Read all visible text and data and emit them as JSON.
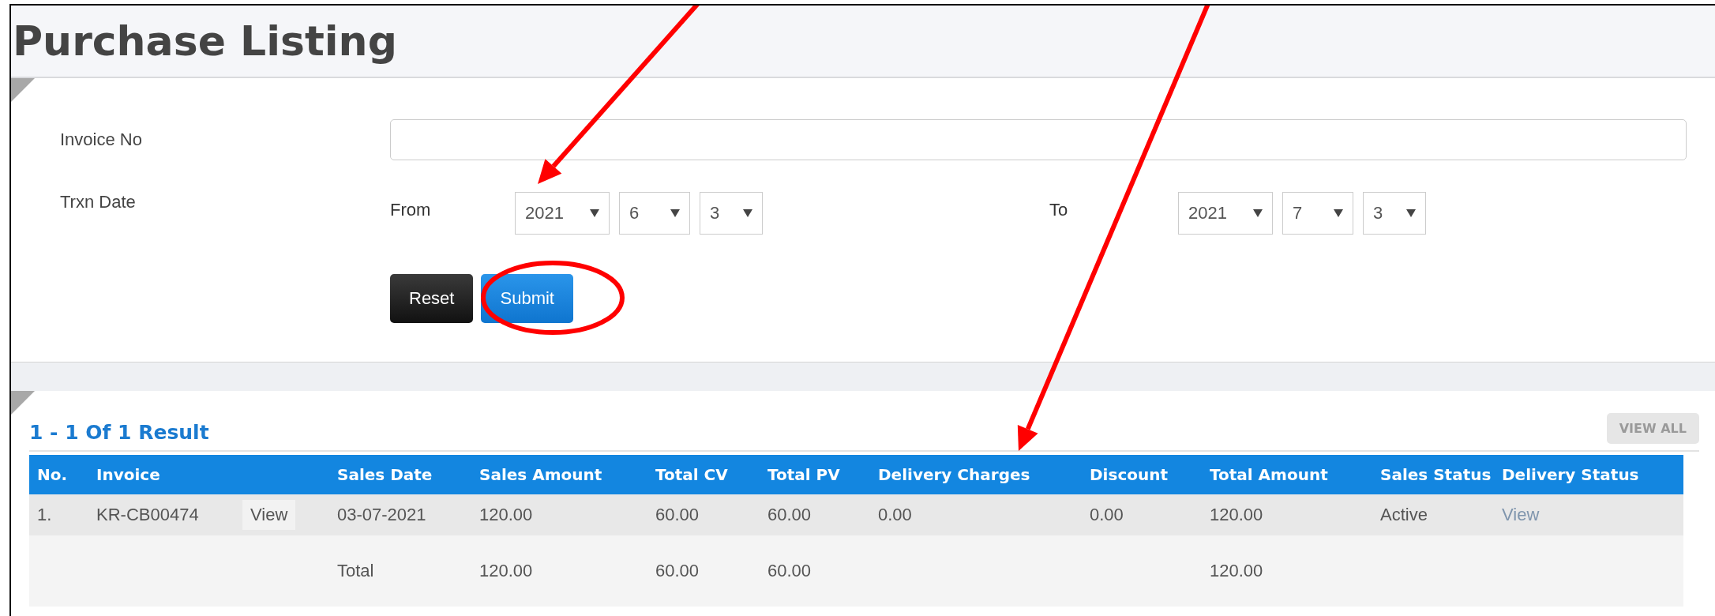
{
  "page_title": "Purchase Listing",
  "filter": {
    "invoice_label": "Invoice No",
    "date_label": "Trxn Date",
    "ranges": [
      {
        "label": "From",
        "year": "2021",
        "month": "6",
        "day": "3"
      },
      {
        "label": "To",
        "year": "2021",
        "month": "7",
        "day": "3"
      }
    ],
    "buttons": [
      {
        "label": "Reset",
        "kind": "dark"
      },
      {
        "label": "Submit",
        "kind": "primary"
      }
    ]
  },
  "results": {
    "summary": "1 - 1 Of 1 Result",
    "view_all": "VIEW ALL",
    "columns": [
      "No.",
      "Invoice",
      "Sales Date",
      "Sales Amount",
      "Total CV",
      "Total PV",
      "Delivery Charges",
      "Discount",
      "Total Amount",
      "Sales Status",
      "Delivery Status"
    ],
    "rows": [
      {
        "no": "1.",
        "invoice": "KR-CB00474",
        "action": "View",
        "sales_date": "03-07-2021",
        "sales_amount": "120.00",
        "total_cv": "60.00",
        "total_pv": "60.00",
        "delivery_charges": "0.00",
        "discount": "0.00",
        "total_amount": "120.00",
        "sales_status": "Active",
        "delivery_status": "View"
      }
    ],
    "total": {
      "label": "Total",
      "sales_amount": "120.00",
      "total_cv": "60.00",
      "total_pv": "60.00",
      "total_amount": "120.00"
    }
  },
  "annotations": [
    {
      "kind": "arrow"
    },
    {
      "kind": "arrow"
    },
    {
      "kind": "ellipse"
    }
  ]
}
